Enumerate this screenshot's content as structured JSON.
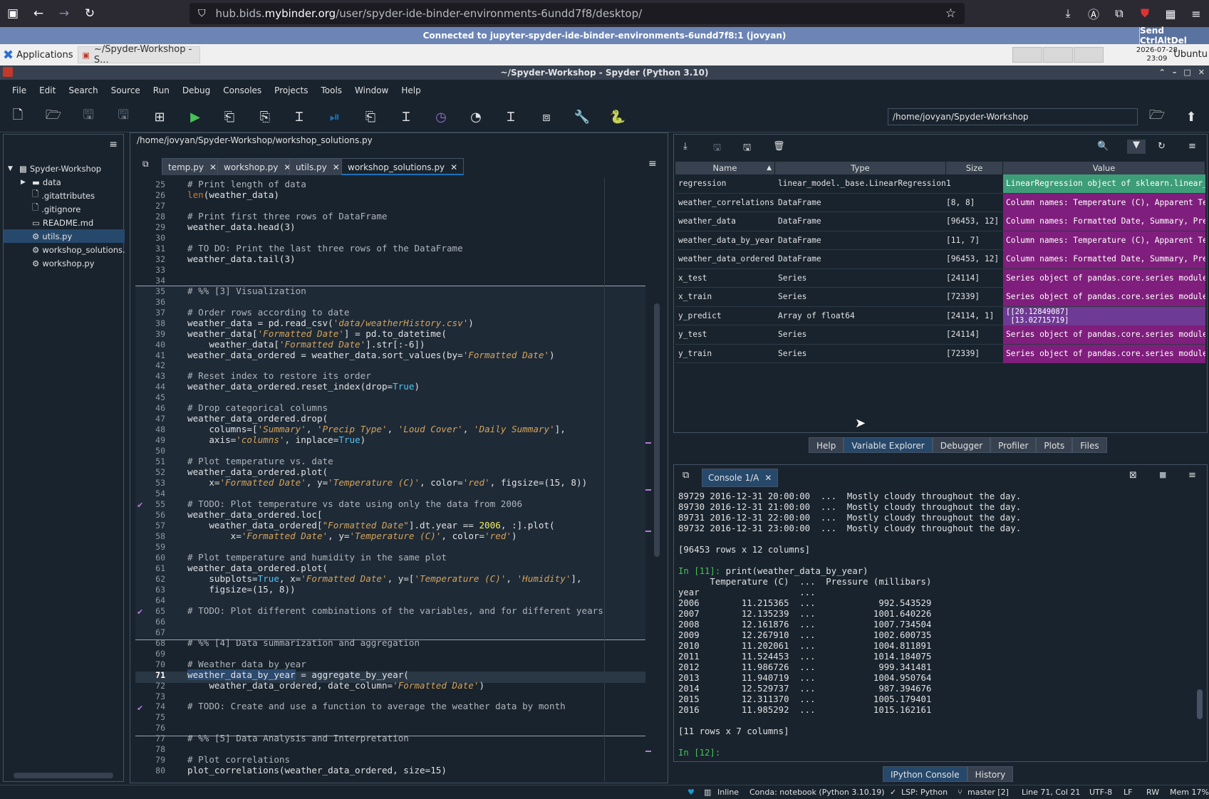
{
  "browser": {
    "url_prefix": "hub.bids.",
    "url_domain": "mybinder.org",
    "url_path": "/user/spyder-ide-binder-environments-6undd7f8/desktop/"
  },
  "vnc": {
    "status": "Connected to jupyter-spyder-ide-binder-environments-6undd7f8:1 (jovyan)",
    "send_cad": "Send CtrlAltDel"
  },
  "panel": {
    "applications": "Applications",
    "task": "~/Spyder-Workshop - S...",
    "date": "2026-07-28",
    "time": "23:09",
    "user": "Ubuntu"
  },
  "window": {
    "title": "~/Spyder-Workshop - Spyder (Python 3.10)"
  },
  "menu": [
    "File",
    "Edit",
    "Search",
    "Source",
    "Run",
    "Debug",
    "Consoles",
    "Projects",
    "Tools",
    "Window",
    "Help"
  ],
  "toolbar": {
    "working_dir": "/home/jovyan/Spyder-Workshop"
  },
  "files": {
    "root": "Spyder-Workshop",
    "items": [
      "data",
      ".gitattributes",
      ".gitignore",
      "README.md",
      "utils.py",
      "workshop_solutions.py",
      "workshop.py"
    ]
  },
  "editor": {
    "path": "/home/jovyan/Spyder-Workshop/workshop_solutions.py",
    "tabs": [
      "temp.py",
      "workshop.py",
      "utils.py",
      "workshop_solutions.py"
    ],
    "active_tab": "workshop_solutions.py"
  },
  "varexp": {
    "headers": [
      "Name",
      "Type",
      "Size",
      "Value"
    ],
    "rows": [
      {
        "name": "regression",
        "type": "linear_model._base.LinearRegression",
        "size": "1",
        "value": "LinearRegression object of sklearn.linear_…",
        "color": "#3e9d79"
      },
      {
        "name": "weather_correlations",
        "type": "DataFrame",
        "size": "[8, 8]",
        "value": "Column names: Temperature (C), Apparent Te…",
        "color": "#7f1e7c"
      },
      {
        "name": "weather_data",
        "type": "DataFrame",
        "size": "[96453, 12]",
        "value": "Column names: Formatted Date, Summary, Pre…",
        "color": "#7f1e7c"
      },
      {
        "name": "weather_data_by_year",
        "type": "DataFrame",
        "size": "[11, 7]",
        "value": "Column names: Temperature (C), Apparent Te…",
        "color": "#7f1e7c"
      },
      {
        "name": "weather_data_ordered",
        "type": "DataFrame",
        "size": "[96453, 12]",
        "value": "Column names: Formatted Date, Summary, Pre…",
        "color": "#7f1e7c"
      },
      {
        "name": "x_test",
        "type": "Series",
        "size": "[24114]",
        "value": "Series object of pandas.core.series module",
        "color": "#7f1e7c"
      },
      {
        "name": "x_train",
        "type": "Series",
        "size": "[72339]",
        "value": "Series object of pandas.core.series module",
        "color": "#7f1e7c"
      },
      {
        "name": "y_predict",
        "type": "Array of float64",
        "size": "[24114, 1]",
        "value": "[[20.12849087]\n [13.02715719]",
        "color": "#6e3a93"
      },
      {
        "name": "y_test",
        "type": "Series",
        "size": "[24114]",
        "value": "Series object of pandas.core.series module",
        "color": "#7f1e7c"
      },
      {
        "name": "y_train",
        "type": "Series",
        "size": "[72339]",
        "value": "Series object of pandas.core.series module",
        "color": "#7f1e7c"
      }
    ],
    "bottom_tabs": [
      "Help",
      "Variable Explorer",
      "Debugger",
      "Profiler",
      "Plots",
      "Files"
    ],
    "active_bottom_tab": "Variable Explorer"
  },
  "console": {
    "tab": "Console 1/A",
    "lines": [
      "89729 2016-12-31 20:00:00  ...  Mostly cloudy throughout the day.",
      "89730 2016-12-31 21:00:00  ...  Mostly cloudy throughout the day.",
      "89731 2016-12-31 22:00:00  ...  Mostly cloudy throughout the day.",
      "89732 2016-12-31 23:00:00  ...  Mostly cloudy throughout the day.",
      "",
      "[96453 rows x 12 columns]",
      "",
      "In [11]: print(weather_data_by_year)",
      "      Temperature (C)  ...  Pressure (millibars)",
      "year                   ...",
      "2006        11.215365  ...            992.543529",
      "2007        12.135239  ...           1001.640226",
      "2008        12.161876  ...           1007.734504",
      "2009        12.267910  ...           1002.600735",
      "2010        11.202061  ...           1004.811891",
      "2011        11.524453  ...           1014.184075",
      "2012        11.986726  ...            999.341481",
      "2013        11.940719  ...           1004.950764",
      "2014        12.529737  ...            987.394676",
      "2015        12.311370  ...           1005.179401",
      "2016        11.985292  ...           1015.162161",
      "",
      "[11 rows x 7 columns]",
      "",
      "In [12]: "
    ],
    "bottom_tabs": [
      "IPython Console",
      "History"
    ],
    "active_bottom_tab": "IPython Console"
  },
  "status": {
    "inline": "Inline",
    "conda": "Conda: notebook (Python 3.10.19)",
    "lsp": "LSP: Python",
    "git": "master [2]",
    "position": "Line 71, Col 21",
    "encoding": "UTF-8",
    "eol": "LF",
    "rw": "RW",
    "mem": "Mem 17%"
  }
}
